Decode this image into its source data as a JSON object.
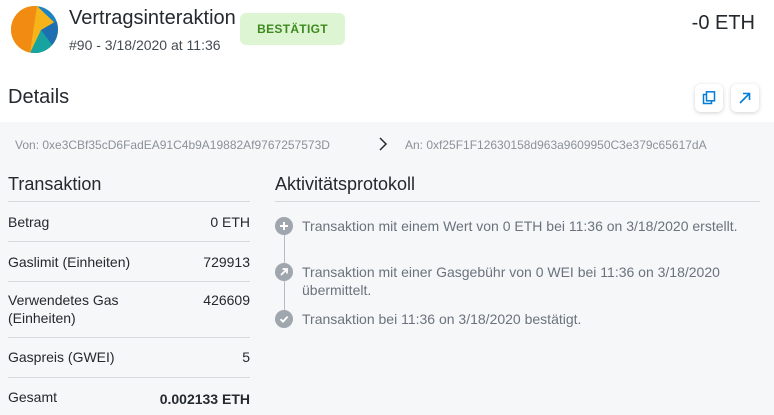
{
  "header": {
    "title": "Vertragsinteraktion",
    "subtitle": "#90 - 3/18/2020 at 11:36",
    "status_badge": "BESTÄTIGT",
    "amount": "-0 ETH"
  },
  "details": {
    "title": "Details",
    "copy_icon": "copy-icon",
    "open_icon": "external-link-icon"
  },
  "addresses": {
    "from": "Von: 0xe3CBf35cD6FadEA91C4b9A19882Af9767257573D",
    "to": "An: 0xf25F1F12630158d963a9609950C3e379c65617dA",
    "arrow_icon": "chevron-right-icon"
  },
  "transaction": {
    "heading": "Transaktion",
    "rows": [
      {
        "label": "Betrag",
        "value": "0 ETH"
      },
      {
        "label": "Gaslimit (Einheiten)",
        "value": "729913"
      },
      {
        "label": "Verwendetes Gas (Einheiten)",
        "value": "426609"
      },
      {
        "label": "Gaspreis (GWEI)",
        "value": "5"
      },
      {
        "label": "Gesamt",
        "value": "0.002133 ETH"
      }
    ]
  },
  "activity": {
    "heading": "Aktivitätsprotokoll",
    "items": [
      {
        "icon": "plus-icon",
        "text": "Transaktion mit einem Wert von 0 ETH bei 11:36 on 3/18/2020 erstellt."
      },
      {
        "icon": "arrow-up-right-icon",
        "text": "Transaktion mit einer Gasgebühr von 0 WEI bei 11:36 on 3/18/2020 übermittelt."
      },
      {
        "icon": "check-icon",
        "text": "Transaktion bei 11:36 on 3/18/2020 bestätigt."
      }
    ]
  },
  "colors": {
    "badge_bg": "#def5d3",
    "badge_text": "#3e8a1f",
    "accent": "#037dd6",
    "panel_bg": "#f6f7f9"
  }
}
